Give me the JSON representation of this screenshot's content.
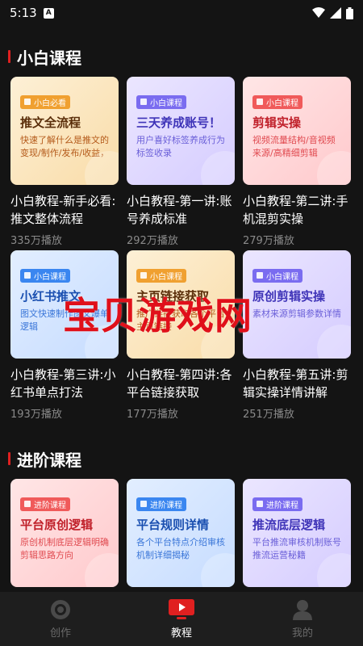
{
  "status": {
    "time": "5:13",
    "badge": "A"
  },
  "sections": [
    {
      "title": "小白课程",
      "cards": [
        {
          "theme": "orange",
          "tag": "小白必看",
          "headline": "推文全流程",
          "sub": "快速了解什么是推文的变现/制作/发布/收益，",
          "title": "小白教程-新手必看:推文整体流程",
          "plays": "335万播放"
        },
        {
          "theme": "purple",
          "tag": "小白课程",
          "headline": "三天养成账号！",
          "sub": "用户喜好标签养成行为标签收录",
          "title": "小白教程-第一讲:账号养成标准",
          "plays": "292万播放"
        },
        {
          "theme": "pink",
          "tag": "小白课程",
          "headline": "剪辑实操",
          "sub": "视频流量结构/音视频来源/高精细剪辑",
          "title": "小白教程-第二讲:手机混剪实操",
          "plays": "279万播放"
        },
        {
          "theme": "blue",
          "tag": "小白课程",
          "headline": "小红书推文",
          "sub": "图文快速制作图文爆单逻辑",
          "title": "小白教程-第三讲:小红书单点打法",
          "plays": "193万播放"
        },
        {
          "theme": "orange",
          "tag": "小白课程",
          "headline": "主页链接获取",
          "sub": "推广链接获取各个平台主页链接",
          "title": "小白教程-第四讲:各平台链接获取",
          "plays": "177万播放"
        },
        {
          "theme": "purple",
          "tag": "小白课程",
          "headline": "原创剪辑实操",
          "sub": "素材来源剪辑参数详情",
          "title": "小白教程-第五讲:剪辑实操详情讲解",
          "plays": "251万播放"
        }
      ]
    },
    {
      "title": "进阶课程",
      "cards": [
        {
          "theme": "pink",
          "tag": "进阶课程",
          "headline": "平台原创逻辑",
          "sub": "原创机制底层逻辑明确剪辑思路方向",
          "title": "",
          "plays": ""
        },
        {
          "theme": "blue",
          "tag": "进阶课程",
          "headline": "平台规则详情",
          "sub": "各个平台特点介绍审核机制详细揭秘",
          "title": "",
          "plays": ""
        },
        {
          "theme": "purple",
          "tag": "进阶课程",
          "headline": "推流底层逻辑",
          "sub": "平台推流审核机制账号推流运营秘籍",
          "title": "",
          "plays": ""
        }
      ]
    }
  ],
  "watermark": "宝贝游戏网",
  "tabbar": {
    "tabs": [
      {
        "label": "创作",
        "icon": "target-icon",
        "active": false
      },
      {
        "label": "教程",
        "icon": "video-icon",
        "active": true
      },
      {
        "label": "我的",
        "icon": "person-icon",
        "active": false
      }
    ]
  },
  "colors": {
    "accent": "#e02020",
    "background": "#141414",
    "tabbar": "#1e1e1e"
  }
}
